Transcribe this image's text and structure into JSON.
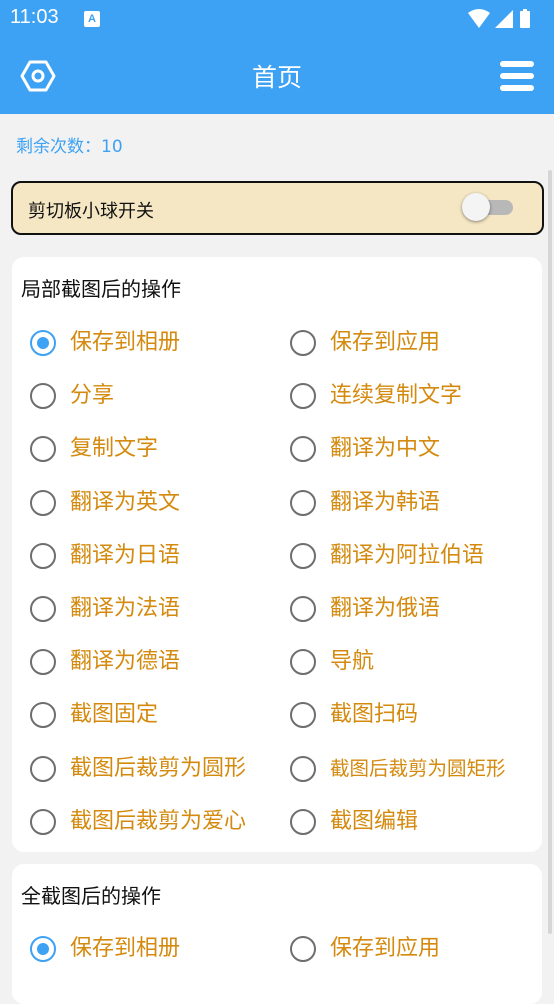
{
  "status_bar": {
    "time": "11:03",
    "app_icon_letter": "A"
  },
  "app_bar": {
    "title": "首页",
    "settings_icon": "hexagon-settings-icon",
    "menu_icon": "hamburger-menu-icon"
  },
  "remaining": {
    "label": "剩余次数：",
    "count": "10"
  },
  "clipboard_toggle": {
    "label": "剪切板小球开关",
    "enabled": false
  },
  "partial_section": {
    "title": "局部截图后的操作",
    "options": [
      {
        "label": "保存到相册",
        "checked": true
      },
      {
        "label": "保存到应用",
        "checked": false
      },
      {
        "label": "分享",
        "checked": false
      },
      {
        "label": "连续复制文字",
        "checked": false
      },
      {
        "label": "复制文字",
        "checked": false
      },
      {
        "label": "翻译为中文",
        "checked": false
      },
      {
        "label": "翻译为英文",
        "checked": false
      },
      {
        "label": "翻译为韩语",
        "checked": false
      },
      {
        "label": "翻译为日语",
        "checked": false
      },
      {
        "label": "翻译为阿拉伯语",
        "checked": false
      },
      {
        "label": "翻译为法语",
        "checked": false
      },
      {
        "label": "翻译为俄语",
        "checked": false
      },
      {
        "label": "翻译为德语",
        "checked": false
      },
      {
        "label": "导航",
        "checked": false
      },
      {
        "label": "截图固定",
        "checked": false
      },
      {
        "label": "截图扫码",
        "checked": false
      },
      {
        "label": "截图后裁剪为圆形",
        "checked": false
      },
      {
        "label": "截图后裁剪为圆矩形",
        "checked": false
      },
      {
        "label": "截图后裁剪为爱心",
        "checked": false
      },
      {
        "label": "截图编辑",
        "checked": false
      }
    ]
  },
  "full_section": {
    "title": "全截图后的操作",
    "options": [
      {
        "label": "保存到相册",
        "checked": true
      },
      {
        "label": "保存到应用",
        "checked": false
      }
    ]
  },
  "colors": {
    "primary": "#3da2f4",
    "option_text": "#d48a0e",
    "toggle_card_bg": "#f5e7c4"
  }
}
